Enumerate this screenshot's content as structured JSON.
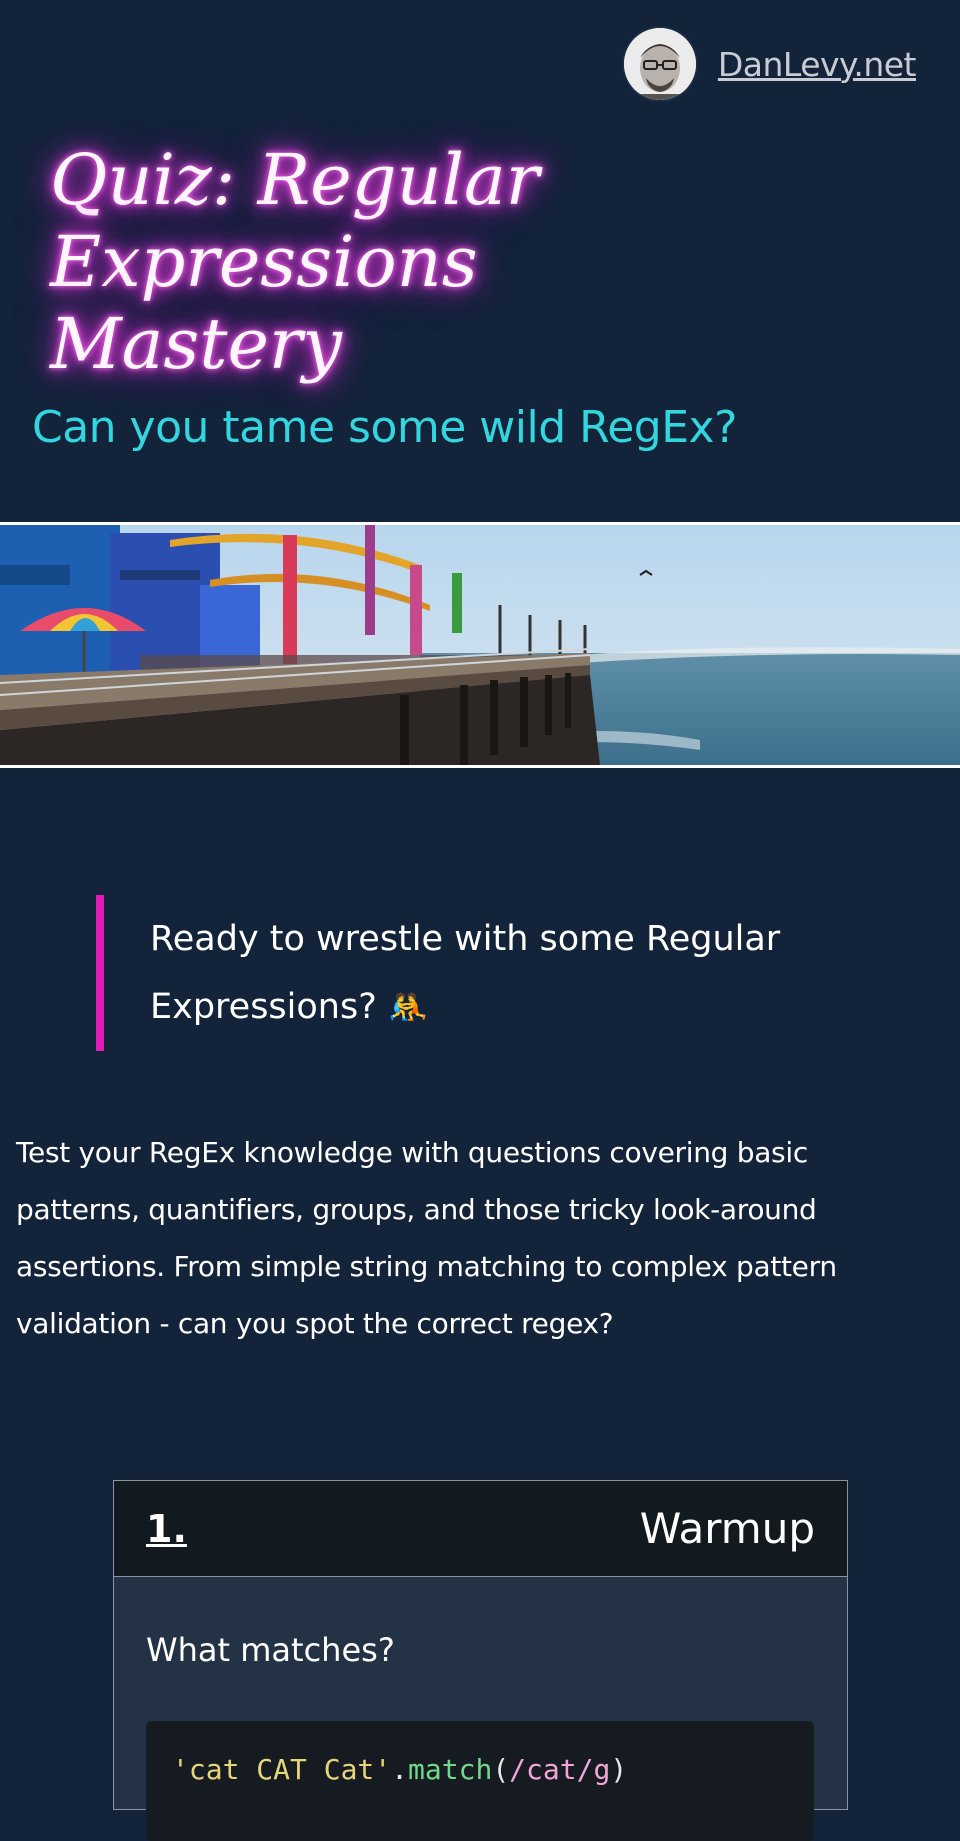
{
  "header": {
    "site_name": "DanLevy.net",
    "avatar_icon": "avatar-icon"
  },
  "title": "Quiz: Regular Expressions Mastery",
  "subtitle": "Can you tame some wild RegEx?",
  "hero_image": "hero-pier-image",
  "callout": {
    "text": "Ready to wrestle with some Regular Expressions? ",
    "emoji": "🤼"
  },
  "intro": "Test your RegEx knowledge with questions covering basic patterns, quantifiers, groups, and those tricky look-around assertions. From simple string matching to complex pattern validation - can you spot the correct regex?",
  "question": {
    "number": "1.",
    "category": "Warmup",
    "prompt": "What matches?",
    "code": {
      "string": "'cat CAT Cat'",
      "dot": ".",
      "method": "match",
      "paren_open": "(",
      "regex": "/cat/",
      "flag": "g",
      "paren_close": ")"
    }
  },
  "colors": {
    "background": "#12233a",
    "subtitle": "#33d6de",
    "callout_border": "#e01bb8",
    "title_glow": "#e83ee6"
  }
}
